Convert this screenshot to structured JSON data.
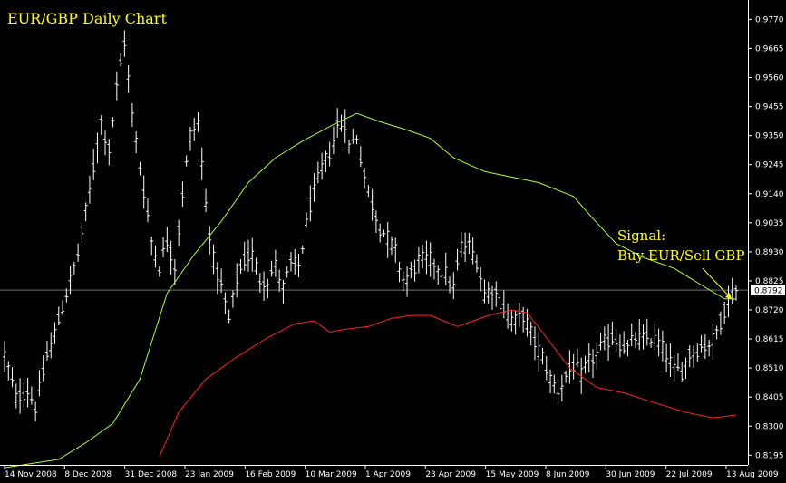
{
  "chart_data": {
    "type": "ohlc",
    "title": "EUR/GBP Daily Chart",
    "annotation": {
      "line1": "Signal:",
      "line2": "Buy EUR/Sell GBP"
    },
    "price_label": "0.8792",
    "current_price": 0.8792,
    "ylim": [
      0.816,
      0.984
    ],
    "yticks": [
      "0.9770",
      "0.9665",
      "0.9560",
      "0.9455",
      "0.9350",
      "0.9245",
      "0.9140",
      "0.9035",
      "0.8930",
      "0.8825",
      "0.8720",
      "0.8615",
      "0.8510",
      "0.8405",
      "0.8300",
      "0.8195"
    ],
    "xlabels": [
      "14 Nov 2008",
      "8 Dec 2008",
      "31 Dec 2008",
      "23 Jan 2009",
      "16 Feb 2009",
      "10 Mar 2009",
      "1 Apr 2009",
      "23 Apr 2009",
      "15 May 2009",
      "8 Jun 2009",
      "30 Jun 2009",
      "22 Jul 2009",
      "13 Aug 2009"
    ],
    "colors": {
      "background": "#000000",
      "bars": "#ffffff",
      "title": "#ffff00",
      "sma_long": "#aaff33",
      "sma_short": "#ff2222",
      "axis": "#ffffff",
      "price_line": "#b5b5b5"
    },
    "price_anchors": [
      [
        0,
        0.856
      ],
      [
        3,
        0.84
      ],
      [
        6,
        0.843
      ],
      [
        8,
        0.837
      ],
      [
        11,
        0.855
      ],
      [
        14,
        0.868
      ],
      [
        16,
        0.878
      ],
      [
        19,
        0.892
      ],
      [
        22,
        0.915
      ],
      [
        25,
        0.94
      ],
      [
        27,
        0.93
      ],
      [
        29,
        0.952
      ],
      [
        31,
        0.969
      ],
      [
        33,
        0.942
      ],
      [
        36,
        0.915
      ],
      [
        38,
        0.897
      ],
      [
        40,
        0.888
      ],
      [
        42,
        0.897
      ],
      [
        44,
        0.888
      ],
      [
        46,
        0.914
      ],
      [
        48,
        0.935
      ],
      [
        50,
        0.94
      ],
      [
        52,
        0.91
      ],
      [
        54,
        0.89
      ],
      [
        56,
        0.88
      ],
      [
        58,
        0.868
      ],
      [
        60,
        0.883
      ],
      [
        62,
        0.89
      ],
      [
        64,
        0.892
      ],
      [
        66,
        0.883
      ],
      [
        68,
        0.883
      ],
      [
        70,
        0.888
      ],
      [
        72,
        0.88
      ],
      [
        74,
        0.888
      ],
      [
        76,
        0.888
      ],
      [
        79,
        0.91
      ],
      [
        82,
        0.923
      ],
      [
        84,
        0.929
      ],
      [
        86,
        0.938
      ],
      [
        88,
        0.94
      ],
      [
        89,
        0.931
      ],
      [
        91,
        0.935
      ],
      [
        93,
        0.92
      ],
      [
        95,
        0.91
      ],
      [
        97,
        0.902
      ],
      [
        99,
        0.898
      ],
      [
        101,
        0.893
      ],
      [
        103,
        0.883
      ],
      [
        105,
        0.885
      ],
      [
        107,
        0.89
      ],
      [
        110,
        0.89
      ],
      [
        112,
        0.888
      ],
      [
        114,
        0.885
      ],
      [
        116,
        0.88
      ],
      [
        118,
        0.895
      ],
      [
        120,
        0.895
      ],
      [
        122,
        0.89
      ],
      [
        124,
        0.878
      ],
      [
        126,
        0.88
      ],
      [
        128,
        0.875
      ],
      [
        130,
        0.87
      ],
      [
        132,
        0.868
      ],
      [
        134,
        0.87
      ],
      [
        135,
        0.867
      ],
      [
        137,
        0.86
      ],
      [
        139,
        0.855
      ],
      [
        141,
        0.847
      ],
      [
        143,
        0.843
      ],
      [
        145,
        0.848
      ],
      [
        147,
        0.852
      ],
      [
        149,
        0.848
      ],
      [
        151,
        0.853
      ],
      [
        153,
        0.856
      ],
      [
        155,
        0.86
      ],
      [
        157,
        0.862
      ],
      [
        159,
        0.86
      ],
      [
        161,
        0.858
      ],
      [
        163,
        0.862
      ],
      [
        165,
        0.861
      ],
      [
        167,
        0.862
      ],
      [
        169,
        0.86
      ],
      [
        171,
        0.856
      ],
      [
        173,
        0.85
      ],
      [
        175,
        0.85
      ],
      [
        177,
        0.856
      ],
      [
        179,
        0.858
      ],
      [
        181,
        0.859
      ],
      [
        183,
        0.861
      ],
      [
        185,
        0.868
      ],
      [
        187,
        0.876
      ],
      [
        189,
        0.8792
      ]
    ],
    "bar_count": 190,
    "sma_long": [
      [
        0,
        0.815
      ],
      [
        14,
        0.818
      ],
      [
        21,
        0.824
      ],
      [
        28,
        0.831
      ],
      [
        35,
        0.847
      ],
      [
        42,
        0.878
      ],
      [
        49,
        0.892
      ],
      [
        56,
        0.904
      ],
      [
        63,
        0.918
      ],
      [
        70,
        0.927
      ],
      [
        77,
        0.933
      ],
      [
        85,
        0.939
      ],
      [
        91,
        0.943
      ],
      [
        97,
        0.94
      ],
      [
        104,
        0.937
      ],
      [
        110,
        0.934
      ],
      [
        116,
        0.927
      ],
      [
        124,
        0.922
      ],
      [
        138,
        0.918
      ],
      [
        147,
        0.913
      ],
      [
        152,
        0.905
      ],
      [
        158,
        0.896
      ],
      [
        165,
        0.891
      ],
      [
        173,
        0.887
      ],
      [
        180,
        0.881
      ],
      [
        186,
        0.876
      ],
      [
        189,
        0.876
      ]
    ],
    "sma_short": [
      [
        40,
        0.819
      ],
      [
        45,
        0.835
      ],
      [
        52,
        0.847
      ],
      [
        60,
        0.855
      ],
      [
        68,
        0.862
      ],
      [
        75,
        0.867
      ],
      [
        80,
        0.868
      ],
      [
        84,
        0.864
      ],
      [
        88,
        0.865
      ],
      [
        94,
        0.866
      ],
      [
        100,
        0.869
      ],
      [
        105,
        0.87
      ],
      [
        110,
        0.87
      ],
      [
        117,
        0.866
      ],
      [
        125,
        0.87
      ],
      [
        131,
        0.872
      ],
      [
        135,
        0.871
      ],
      [
        140,
        0.862
      ],
      [
        146,
        0.851
      ],
      [
        153,
        0.844
      ],
      [
        160,
        0.842
      ],
      [
        169,
        0.838
      ],
      [
        176,
        0.835
      ],
      [
        183,
        0.833
      ],
      [
        189,
        0.834
      ]
    ]
  }
}
